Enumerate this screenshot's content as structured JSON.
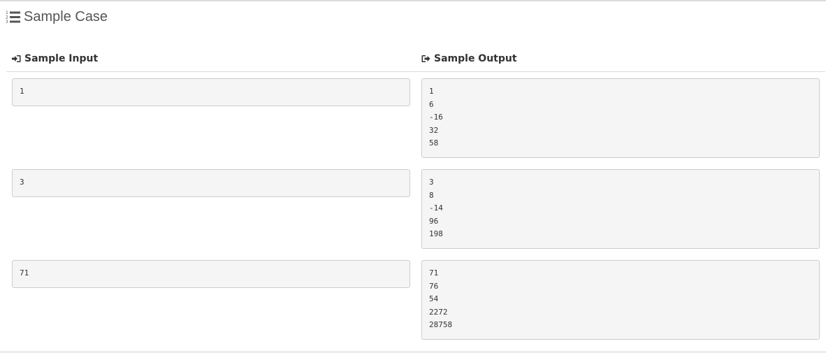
{
  "section": {
    "title": "Sample Case",
    "title_icon": "list-ol-icon"
  },
  "columns": {
    "input_label": "Sample Input",
    "input_icon": "sign-in-icon",
    "output_label": "Sample Output",
    "output_icon": "sign-out-icon"
  },
  "cases": [
    {
      "input": "1",
      "output": [
        "1",
        "6",
        "-16",
        "32",
        "58"
      ]
    },
    {
      "input": "3",
      "output": [
        "3",
        "8",
        "-14",
        "96",
        "198"
      ]
    },
    {
      "input": "71",
      "output": [
        "71",
        "76",
        "54",
        "2272",
        "28758"
      ]
    }
  ]
}
